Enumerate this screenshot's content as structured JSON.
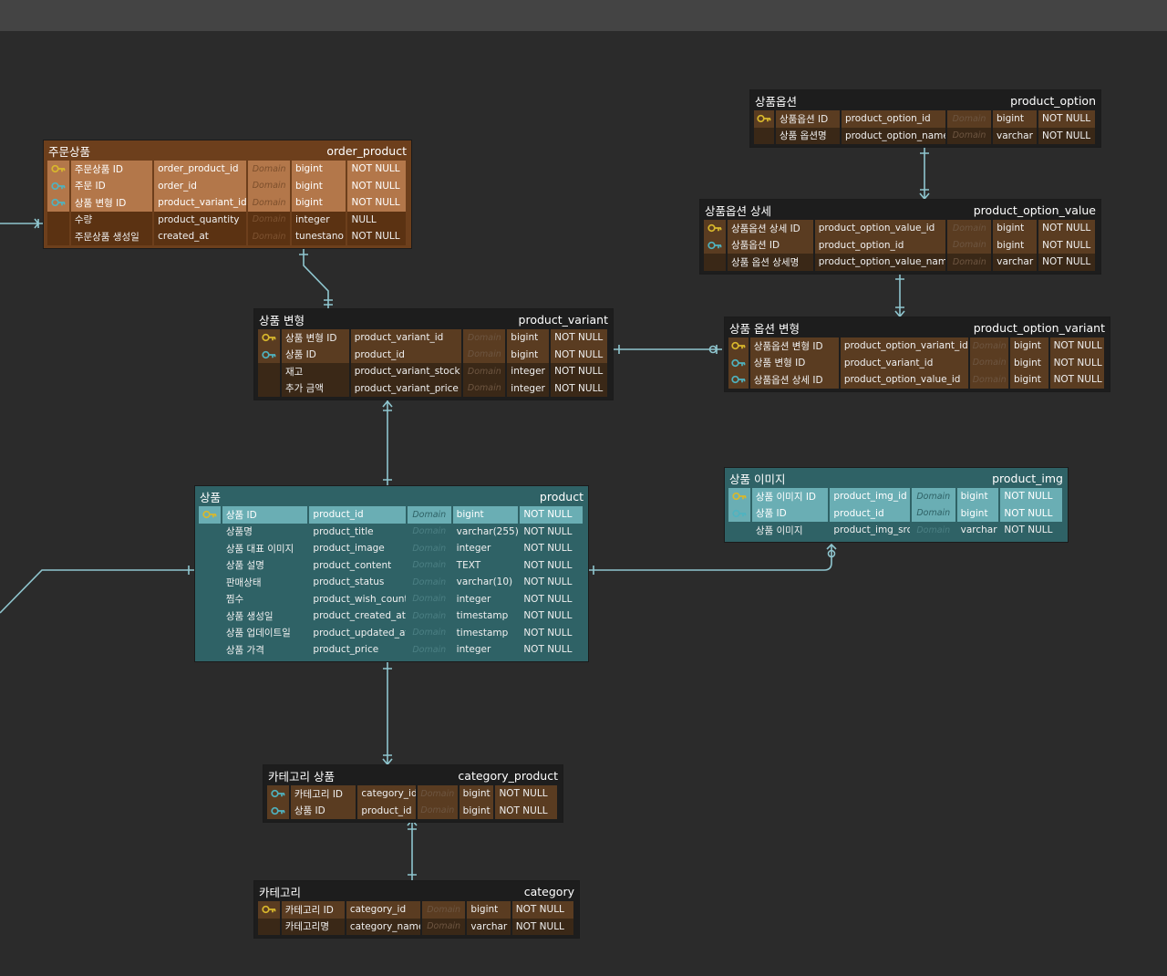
{
  "colors": {
    "canvas": "#2b2b2b",
    "relation_line": "#8fc6cf",
    "brown_row": "#5a3c21",
    "order_header": "#6d3f1c",
    "teal_header": "#2f6266",
    "pk_icon": "#d9b82c",
    "fk_icon": "#4fb3c0"
  },
  "tables": {
    "product_option": {
      "logical": "상품옵션",
      "physical": "product_option",
      "rows": [
        {
          "key": "pk",
          "logical": "상품옵션 ID",
          "physical": "product_option_id",
          "domain": "Domain",
          "type": "bigint",
          "null": "NOT NULL"
        },
        {
          "key": "",
          "logical": "상품 옵션명",
          "physical": "product_option_name",
          "domain": "Domain",
          "type": "varchar",
          "null": "NOT NULL"
        }
      ]
    },
    "order_product": {
      "logical": "주문상품",
      "physical": "order_product",
      "rows": [
        {
          "key": "pk",
          "logical": "주문상품 ID",
          "physical": "order_product_id",
          "domain": "Domain",
          "type": "bigint",
          "null": "NOT NULL"
        },
        {
          "key": "fk",
          "logical": "주문 ID",
          "physical": "order_id",
          "domain": "Domain",
          "type": "bigint",
          "null": "NOT NULL"
        },
        {
          "key": "fk",
          "logical": "상품 변형 ID",
          "physical": "product_variant_id",
          "domain": "Domain",
          "type": "bigint",
          "null": "NOT NULL"
        },
        {
          "key": "",
          "logical": "수량",
          "physical": "product_quantity",
          "domain": "Domain",
          "type": "integer",
          "null": "NULL"
        },
        {
          "key": "",
          "logical": "주문상품 생성일",
          "physical": "created_at",
          "domain": "Domain",
          "type": "tunestano",
          "null": "NOT NULL"
        }
      ]
    },
    "product_option_value": {
      "logical": "상품옵션 상세",
      "physical": "product_option_value",
      "rows": [
        {
          "key": "pk",
          "logical": "상품옵션 상세 ID",
          "physical": "product_option_value_id",
          "domain": "Domain",
          "type": "bigint",
          "null": "NOT NULL"
        },
        {
          "key": "fk",
          "logical": "상품옵션 ID",
          "physical": "product_option_id",
          "domain": "Domain",
          "type": "bigint",
          "null": "NOT NULL"
        },
        {
          "key": "",
          "logical": "상품 옵션 상세명",
          "physical": "product_option_value_name",
          "domain": "Domain",
          "type": "varchar",
          "null": "NOT NULL"
        }
      ]
    },
    "product_variant": {
      "logical": "상품 변형",
      "physical": "product_variant",
      "rows": [
        {
          "key": "pk",
          "logical": "상품 변형 ID",
          "physical": "product_variant_id",
          "domain": "Domain",
          "type": "bigint",
          "null": "NOT NULL"
        },
        {
          "key": "fk",
          "logical": "상품 ID",
          "physical": "product_id",
          "domain": "Domain",
          "type": "bigint",
          "null": "NOT NULL"
        },
        {
          "key": "",
          "logical": "재고",
          "physical": "product_variant_stock",
          "domain": "Domain",
          "type": "integer",
          "null": "NOT NULL"
        },
        {
          "key": "",
          "logical": "추가 금액",
          "physical": "product_variant_price",
          "domain": "Domain",
          "type": "integer",
          "null": "NOT NULL"
        }
      ]
    },
    "product_option_variant": {
      "logical": "상품 옵션 변형",
      "physical": "product_option_variant",
      "rows": [
        {
          "key": "pk",
          "logical": "상품옵션 변형 ID",
          "physical": "product_option_variant_id",
          "domain": "Domain",
          "type": "bigint",
          "null": "NOT NULL"
        },
        {
          "key": "fk",
          "logical": "상품 변형 ID",
          "physical": "product_variant_id",
          "domain": "Domain",
          "type": "bigint",
          "null": "NOT NULL"
        },
        {
          "key": "fk",
          "logical": "상품옵션 상세 ID",
          "physical": "product_option_value_id",
          "domain": "Domain",
          "type": "bigint",
          "null": "NOT NULL"
        }
      ]
    },
    "product_img": {
      "logical": "상품 이미지",
      "physical": "product_img",
      "rows": [
        {
          "key": "pk",
          "logical": "상품 이미지 ID",
          "physical": "product_img_id",
          "domain": "Domain",
          "type": "bigint",
          "null": "NOT NULL"
        },
        {
          "key": "fk",
          "logical": "상품 ID",
          "physical": "product_id",
          "domain": "Domain",
          "type": "bigint",
          "null": "NOT NULL"
        },
        {
          "key": "",
          "logical": "상품 이미지",
          "physical": "product_img_src",
          "domain": "Domain",
          "type": "varchar",
          "null": "NOT NULL"
        }
      ]
    },
    "product": {
      "logical": "상품",
      "physical": "product",
      "rows": [
        {
          "key": "pk",
          "logical": "상품 ID",
          "physical": "product_id",
          "domain": "Domain",
          "type": "bigint",
          "null": "NOT NULL"
        },
        {
          "key": "",
          "logical": "상품명",
          "physical": "product_title",
          "domain": "Domain",
          "type": "varchar(255)",
          "null": "NOT NULL"
        },
        {
          "key": "",
          "logical": "상품 대표 이미지",
          "physical": "product_image",
          "domain": "Domain",
          "type": "integer",
          "null": "NOT NULL"
        },
        {
          "key": "",
          "logical": "상품 설명",
          "physical": "product_content",
          "domain": "Domain",
          "type": "TEXT",
          "null": "NOT NULL"
        },
        {
          "key": "",
          "logical": "판매상태",
          "physical": "product_status",
          "domain": "Domain",
          "type": "varchar(10)",
          "null": "NOT NULL"
        },
        {
          "key": "",
          "logical": "찜수",
          "physical": "product_wish_count",
          "domain": "Domain",
          "type": "integer",
          "null": "NOT NULL"
        },
        {
          "key": "",
          "logical": "상품 생성일",
          "physical": "product_created_at",
          "domain": "Domain",
          "type": "timestamp",
          "null": "NOT NULL"
        },
        {
          "key": "",
          "logical": "상품 업데이트일",
          "physical": "product_updated_at",
          "domain": "Domain",
          "type": "timestamp",
          "null": "NOT NULL"
        },
        {
          "key": "",
          "logical": "상품 가격",
          "physical": "product_price",
          "domain": "Domain",
          "type": "integer",
          "null": "NOT NULL"
        }
      ]
    },
    "category_product": {
      "logical": "카테고리 상품",
      "physical": "category_product",
      "rows": [
        {
          "key": "fk",
          "logical": "카테고리 ID",
          "physical": "category_id",
          "domain": "Domain",
          "type": "bigint",
          "null": "NOT NULL"
        },
        {
          "key": "fk",
          "logical": "상품 ID",
          "physical": "product_id",
          "domain": "Domain",
          "type": "bigint",
          "null": "NOT NULL"
        }
      ]
    },
    "category": {
      "logical": "카테고리",
      "physical": "category",
      "rows": [
        {
          "key": "pk",
          "logical": "카테고리 ID",
          "physical": "category_id",
          "domain": "Domain",
          "type": "bigint",
          "null": "NOT NULL"
        },
        {
          "key": "",
          "logical": "카테고리명",
          "physical": "category_name",
          "domain": "Domain",
          "type": "varchar",
          "null": "NOT NULL"
        }
      ]
    }
  }
}
